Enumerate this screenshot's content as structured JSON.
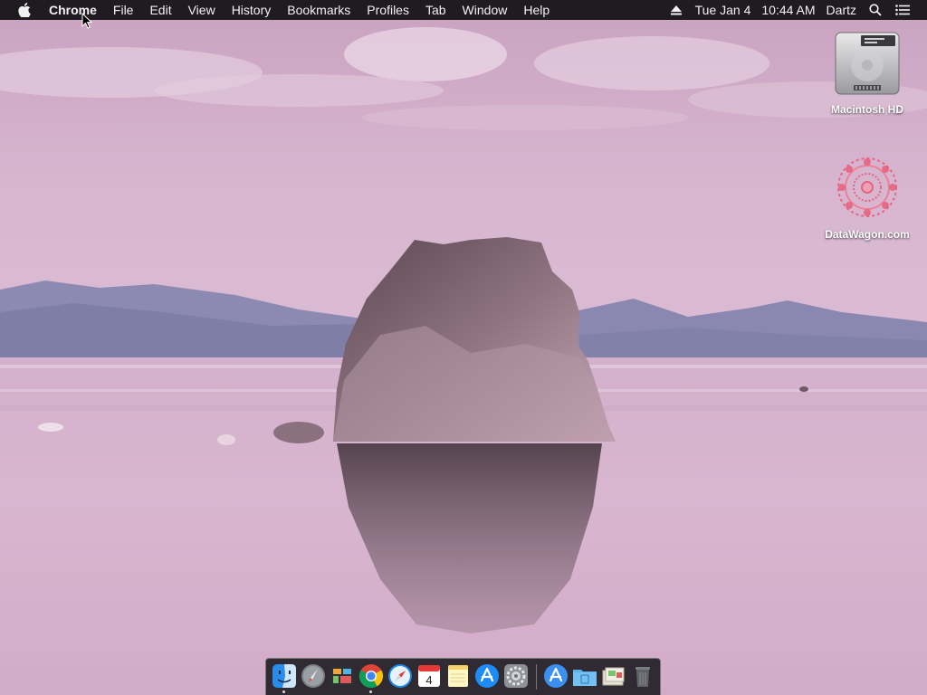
{
  "menubar": {
    "app_name": "Chrome",
    "menus": [
      "File",
      "Edit",
      "View",
      "History",
      "Bookmarks",
      "Profiles",
      "Tab",
      "Window",
      "Help"
    ],
    "date": "Tue Jan 4",
    "time": "10:44 AM",
    "user": "Dartz"
  },
  "desktop": {
    "icons": [
      {
        "label": "Macintosh HD",
        "icon": "hard-drive-icon"
      },
      {
        "label": "DataWagon.com",
        "icon": "mandala-icon"
      }
    ]
  },
  "dock": {
    "items": [
      {
        "name": "finder",
        "icon": "finder-icon",
        "running": true
      },
      {
        "name": "launchpad",
        "icon": "launchpad-icon",
        "running": false
      },
      {
        "name": "mission-control",
        "icon": "mission-control-icon",
        "running": false
      },
      {
        "name": "chrome",
        "icon": "chrome-icon",
        "running": true
      },
      {
        "name": "safari",
        "icon": "safari-icon",
        "running": false
      },
      {
        "name": "calendar",
        "icon": "calendar-icon",
        "running": false,
        "day": "4"
      },
      {
        "name": "notes",
        "icon": "notes-icon",
        "running": false
      },
      {
        "name": "app-store",
        "icon": "app-store-icon",
        "running": false
      },
      {
        "name": "system-preferences",
        "icon": "system-preferences-icon",
        "running": false
      },
      {
        "name": "applications-folder",
        "icon": "applications-folder-icon",
        "running": false
      },
      {
        "name": "documents-folder",
        "icon": "folder-icon",
        "running": false
      },
      {
        "name": "downloads-stack",
        "icon": "downloads-stack-icon",
        "running": false
      },
      {
        "name": "trash",
        "icon": "trash-icon",
        "running": false
      }
    ]
  },
  "colors": {
    "menubar_bg": "#1f1b20",
    "sky": "#d6b3cd",
    "water": "#d8b4cf"
  }
}
